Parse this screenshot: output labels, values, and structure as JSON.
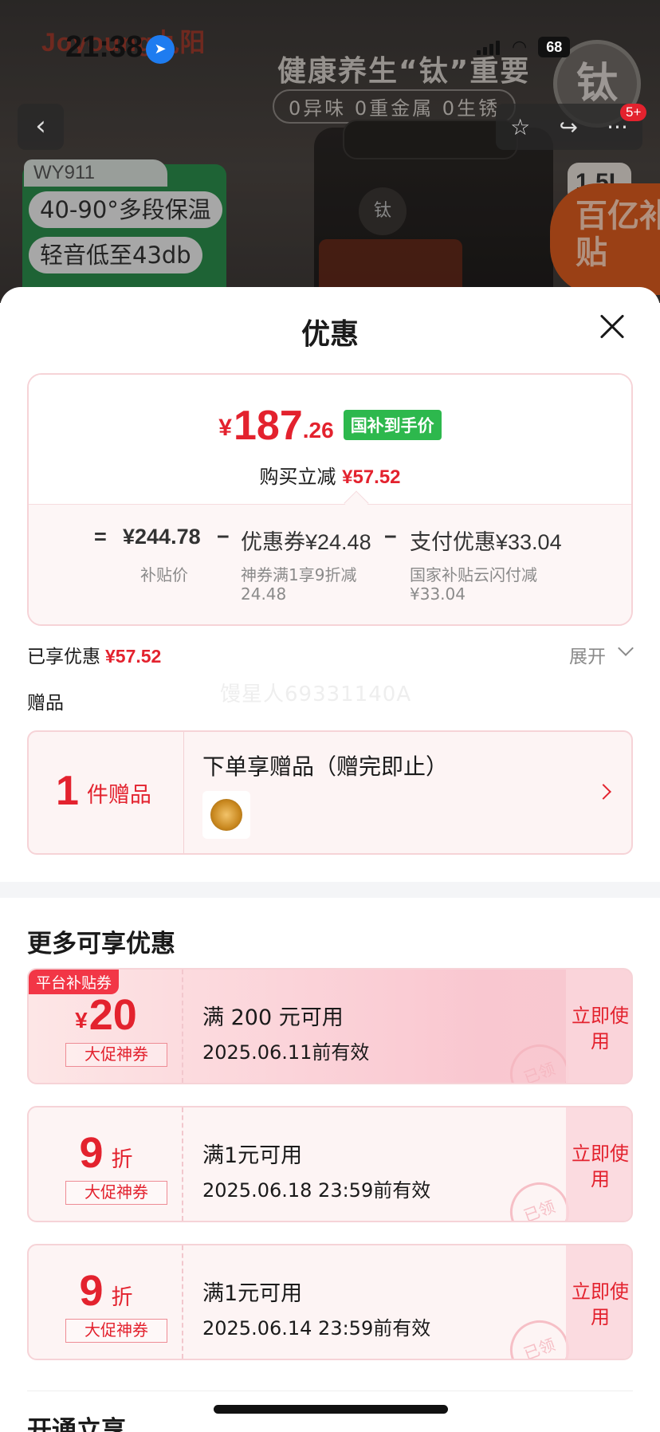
{
  "status_bar": {
    "time": "21:38",
    "battery": "68"
  },
  "hero": {
    "brand": "Joyoung九阳",
    "slogan": "健康养生“钛”重要",
    "sub_slogan": "0异味 0重金属 0生锈",
    "badge": "钛",
    "model": "WY911",
    "features": [
      "40-90°多段保温",
      "轻音低至43db"
    ],
    "capacity": "1.5L",
    "kettle_badge": "钛",
    "message_badge": "5+",
    "subsidy_badge": "百亿补贴",
    "icons": {
      "back": "back-arrow-icon",
      "favorite": "star-icon",
      "share": "share-icon",
      "more": "more-icon",
      "location": "location-arrow-icon"
    }
  },
  "sheet": {
    "title": "优惠",
    "close_icon": "close-icon",
    "price": {
      "currency": "¥",
      "integer": "187",
      "decimal": ".26",
      "tag": "国补到手价",
      "instant_label": "购买立减",
      "instant_amount": "¥57.52"
    },
    "breakdown": {
      "equals": "=",
      "minus": "−",
      "base_value": "¥244.78",
      "base_label": "补贴价",
      "coupon_value": "优惠券¥24.48",
      "coupon_desc1": "神券满1享9折减",
      "coupon_desc2": "24.48",
      "pay_value": "支付优惠¥33.04",
      "pay_desc1": "国家补贴云闪付减",
      "pay_desc2": "¥33.04"
    },
    "enjoyed_label": "已享优惠",
    "enjoyed_amount": "¥57.52",
    "expand_label": "展开",
    "gifts_label": "赠品",
    "watermark": "馒星人69331140A",
    "gift": {
      "count": "1",
      "unit": "件赠品",
      "title": "下单享赠品（赠完即止）"
    },
    "more_title": "更多可享优惠",
    "coupons": [
      {
        "tag": "平台补贴券",
        "currency": "¥",
        "amount": "20",
        "suffix": "",
        "label": "大促神券",
        "condition": "满 200 元可用",
        "validity": "2025.06.11前有效",
        "action": "立即使用",
        "stamp": "已领"
      },
      {
        "tag": "",
        "currency": "",
        "amount": "9",
        "suffix": "折",
        "label": "大促神券",
        "condition": "满1元可用",
        "validity": "2025.06.18 23:59前有效",
        "action": "立即使用",
        "stamp": "已领"
      },
      {
        "tag": "",
        "currency": "",
        "amount": "9",
        "suffix": "折",
        "label": "大促神券",
        "condition": "满1元可用",
        "validity": "2025.06.14 23:59前有效",
        "action": "立即使用",
        "stamp": "已领"
      }
    ],
    "footer_heading": "开通立享"
  }
}
